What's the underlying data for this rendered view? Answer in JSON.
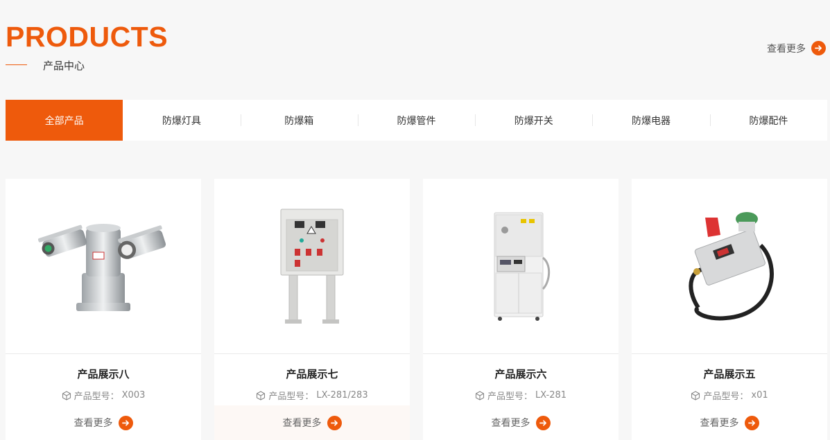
{
  "header": {
    "title_en": "PRODUCTS",
    "title_cn": "产品中心",
    "more_label": "查看更多",
    "accent_color": "#ee5a0c"
  },
  "tabs": [
    {
      "label": "全部产品",
      "active": true
    },
    {
      "label": "防爆灯具",
      "active": false
    },
    {
      "label": "防爆箱",
      "active": false
    },
    {
      "label": "防爆管件",
      "active": false
    },
    {
      "label": "防爆开关",
      "active": false
    },
    {
      "label": "防爆电器",
      "active": false
    },
    {
      "label": "防爆配件",
      "active": false
    }
  ],
  "products": [
    {
      "name": "产品展示八",
      "model_label": "产品型号：",
      "model": "X003",
      "more": "查看更多",
      "image": "explosion-proof-camera"
    },
    {
      "name": "产品展示七",
      "model_label": "产品型号：",
      "model": "LX-281/283",
      "more": "查看更多",
      "image": "distribution-box-on-stand"
    },
    {
      "name": "产品展示六",
      "model_label": "产品型号：",
      "model": "LX-281",
      "more": "查看更多",
      "image": "industrial-cabinet"
    },
    {
      "name": "产品展示五",
      "model_label": "产品型号：",
      "model": "x01",
      "more": "查看更多",
      "image": "junction-box-with-alarm"
    }
  ]
}
